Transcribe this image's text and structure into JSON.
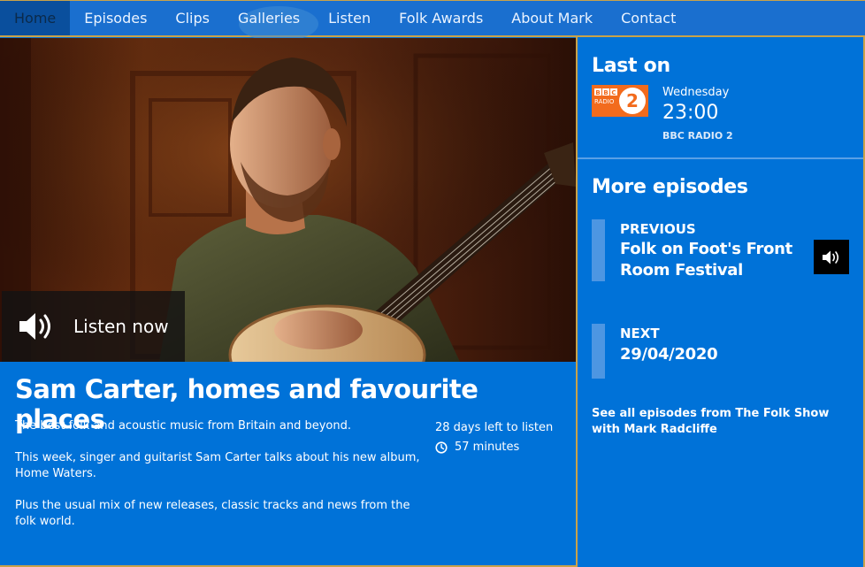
{
  "nav": {
    "items": [
      {
        "label": "Home",
        "active": true
      },
      {
        "label": "Episodes"
      },
      {
        "label": "Clips"
      },
      {
        "label": "Galleries"
      },
      {
        "label": "Listen"
      },
      {
        "label": "Folk Awards"
      },
      {
        "label": "About Mark"
      },
      {
        "label": "Contact"
      }
    ]
  },
  "hero": {
    "listen_label": "Listen now",
    "listen_icon": "speaker-icon"
  },
  "episode": {
    "title": "Sam Carter, homes and favourite places",
    "desc_1": "The best folk and acoustic music from Britain and beyond.",
    "desc_2": "This week, singer and guitarist Sam Carter talks about his new album, Home Waters.",
    "desc_3": "Plus the usual mix of new releases, classic tracks and news from the folk world.",
    "days_left": "28 days left to listen",
    "duration": "57 minutes"
  },
  "last_on": {
    "heading": "Last on",
    "logo_line1": "BBC",
    "logo_line2": "RADIO",
    "logo_number": "2",
    "day": "Wednesday",
    "time": "23:00",
    "station": "BBC RADIO 2"
  },
  "more_episodes": {
    "heading": "More episodes",
    "previous_label": "PREVIOUS",
    "previous_title": "Folk on Foot's Front Room Festival",
    "next_label": "NEXT",
    "next_date": "29/04/2020",
    "see_all": "See all episodes from The Folk Show with Mark Radcliffe"
  },
  "colors": {
    "background": "#0072d8",
    "accent_border": "#c9a24a",
    "logo_orange": "#f26b1d"
  }
}
